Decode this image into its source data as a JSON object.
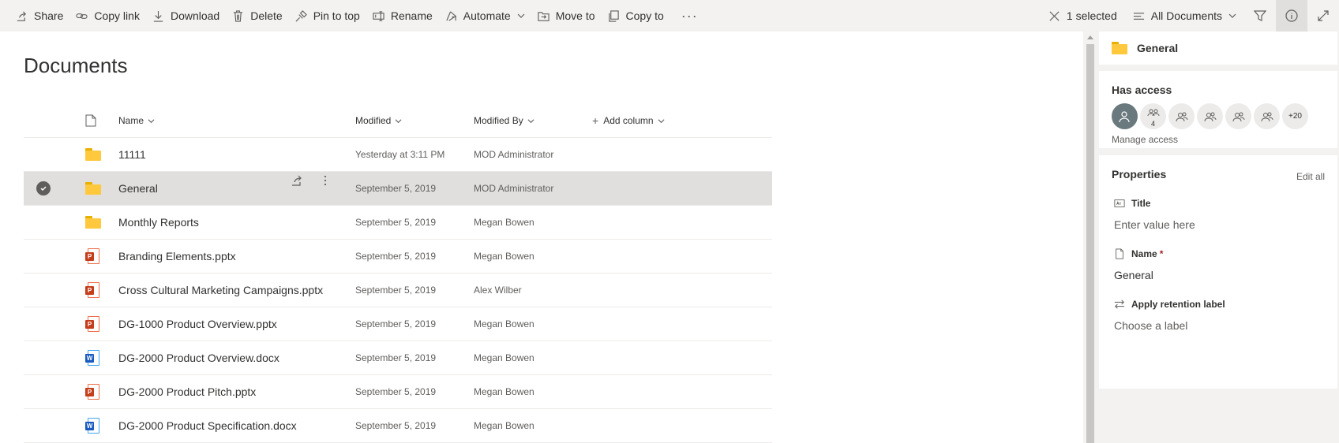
{
  "command_bar": {
    "share": "Share",
    "copy_link": "Copy link",
    "download": "Download",
    "delete": "Delete",
    "pin_to_top": "Pin to top",
    "rename": "Rename",
    "automate": "Automate",
    "move_to": "Move to",
    "copy_to": "Copy to",
    "more": "···",
    "selected_count": "1 selected",
    "view": "All Documents"
  },
  "page_title": "Documents",
  "columns": {
    "name": "Name",
    "modified": "Modified",
    "modified_by": "Modified By",
    "add_column": "Add column"
  },
  "rows": [
    {
      "name": "11111",
      "type": "folder",
      "modified": "Yesterday at 3:11 PM",
      "modified_by": "MOD Administrator",
      "selected": false
    },
    {
      "name": "General",
      "type": "folder",
      "modified": "September 5, 2019",
      "modified_by": "MOD Administrator",
      "selected": true
    },
    {
      "name": "Monthly Reports",
      "type": "folder",
      "modified": "September 5, 2019",
      "modified_by": "Megan Bowen",
      "selected": false
    },
    {
      "name": "Branding Elements.pptx",
      "type": "pptx",
      "modified": "September 5, 2019",
      "modified_by": "Megan Bowen",
      "selected": false
    },
    {
      "name": "Cross Cultural Marketing Campaigns.pptx",
      "type": "pptx",
      "modified": "September 5, 2019",
      "modified_by": "Alex Wilber",
      "selected": false
    },
    {
      "name": "DG-1000 Product Overview.pptx",
      "type": "pptx",
      "modified": "September 5, 2019",
      "modified_by": "Megan Bowen",
      "selected": false
    },
    {
      "name": "DG-2000 Product Overview.docx",
      "type": "docx",
      "modified": "September 5, 2019",
      "modified_by": "Megan Bowen",
      "selected": false
    },
    {
      "name": "DG-2000 Product Pitch.pptx",
      "type": "pptx",
      "modified": "September 5, 2019",
      "modified_by": "Megan Bowen",
      "selected": false
    },
    {
      "name": "DG-2000 Product Specification.docx",
      "type": "docx",
      "modified": "September 5, 2019",
      "modified_by": "Megan Bowen",
      "selected": false
    }
  ],
  "details": {
    "item_name": "General",
    "has_access_title": "Has access",
    "avatars": [
      "",
      "4",
      "",
      "",
      "",
      "",
      "+20"
    ],
    "manage_access": "Manage access",
    "properties_title": "Properties",
    "edit_all": "Edit all",
    "title_label": "Title",
    "title_placeholder": "Enter value here",
    "name_label": "Name",
    "name_required": "*",
    "name_value": "General",
    "retention_label": "Apply retention label",
    "retention_value": "Choose a label"
  },
  "colors": {
    "folder": "#ffc83d",
    "ppt": "#c43e1c",
    "word": "#185abd",
    "selected_row": "#e1dfdd"
  }
}
